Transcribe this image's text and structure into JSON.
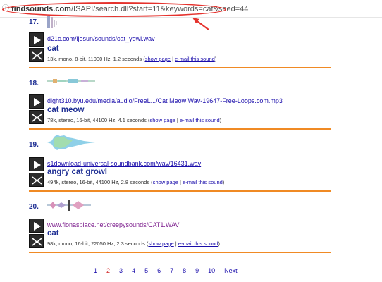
{
  "address_bar": {
    "host": "findsounds.com",
    "path": "/ISAPI/search.dll?start=11&keywords=cat&seed=44",
    "annotation_color": "#e5322d"
  },
  "results": [
    {
      "number": "17.",
      "url": "d21c.com/ljesun/sounds/cat_yowl.wav",
      "title": "cat",
      "meta": "13k, mono, 8-bit, 11000 Hz, 1.2 seconds",
      "show_page": "show page",
      "email": "e-mail this sound",
      "visited": false
    },
    {
      "number": "18.",
      "url": "dight310.byu.edu/media/audio/FreeL.../Cat Meow Wav-19647-Free-Loops.com.mp3",
      "title": "cat meow",
      "meta": "78k, stereo, 16-bit, 44100 Hz, 4.1 seconds",
      "show_page": "show page",
      "email": "e-mail this sound",
      "visited": false
    },
    {
      "number": "19.",
      "url": "s1download-universal-soundbank.com/wav/16431.wav",
      "title": "angry cat growl",
      "meta": "494k, stereo, 16-bit, 44100 Hz, 2.8 seconds",
      "show_page": "show page",
      "email": "e-mail this sound",
      "visited": false
    },
    {
      "number": "20.",
      "url": "www.fionasplace.net/creepysounds/CAT1.WAV",
      "title": "cat",
      "meta": "98k, mono, 16-bit, 22050 Hz, 2.3 seconds",
      "show_page": "show page",
      "email": "e-mail this sound",
      "visited": true
    }
  ],
  "pagination": {
    "pages": [
      "1",
      "2",
      "3",
      "4",
      "5",
      "6",
      "7",
      "8",
      "9",
      "10"
    ],
    "current": "2",
    "next": "Next"
  },
  "colors": {
    "accent_orange": "#f08a24",
    "title_blue": "#1f2f94",
    "link_blue": "#1a0dab",
    "visited_purple": "#7b1b8c"
  }
}
